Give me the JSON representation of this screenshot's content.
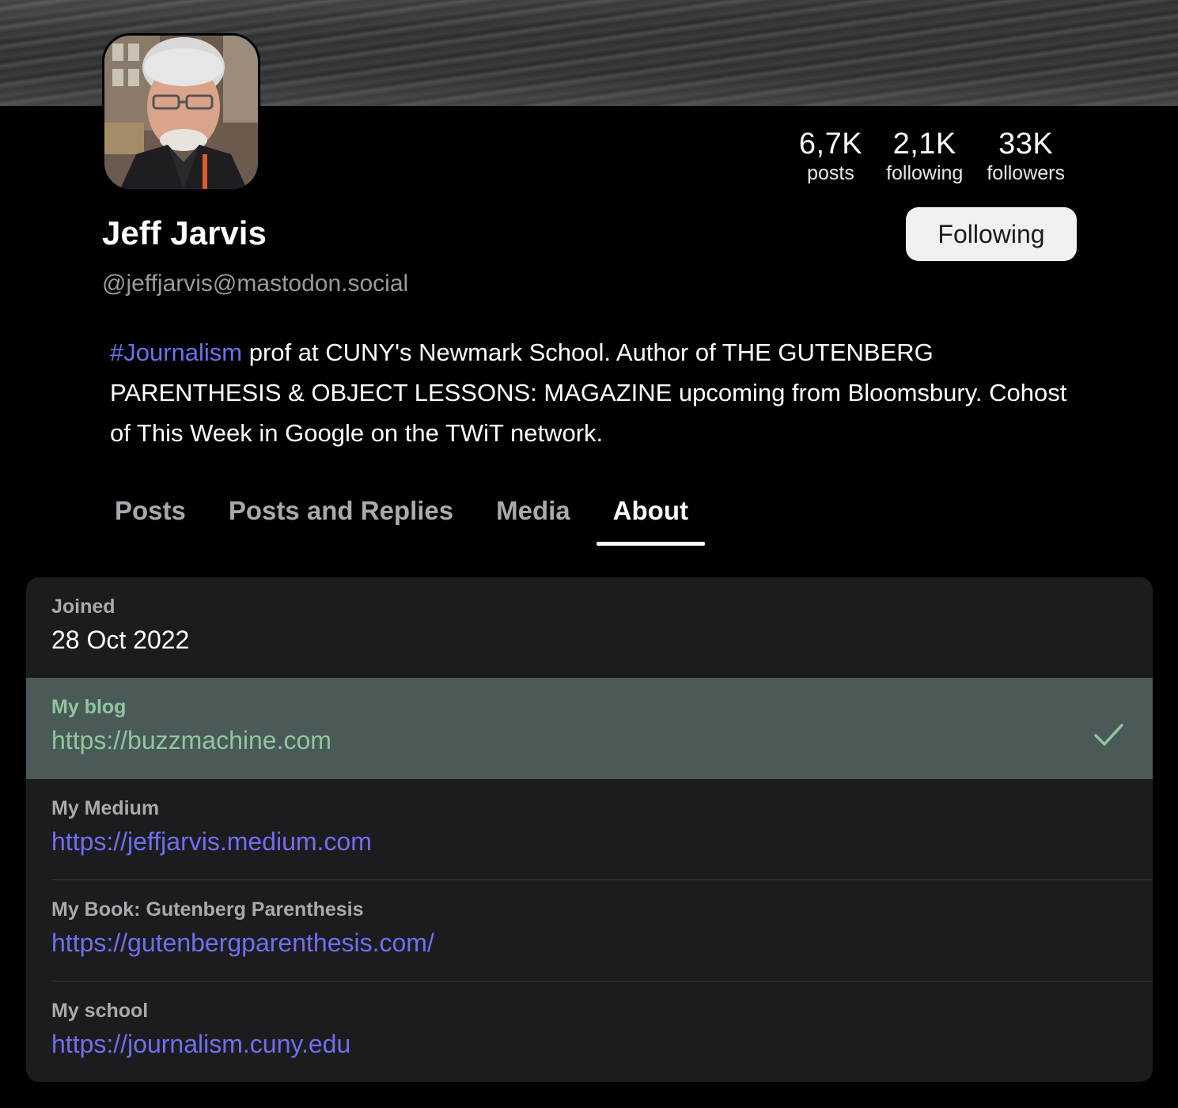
{
  "profile": {
    "display_name": "Jeff Jarvis",
    "handle": "@jeffjarvis@mastodon.social",
    "follow_button": "Following"
  },
  "stats": [
    {
      "value": "6,7K",
      "label": "posts"
    },
    {
      "value": "2,1K",
      "label": "following"
    },
    {
      "value": "33K",
      "label": "followers"
    }
  ],
  "bio": {
    "hashtag": "#Journalism",
    "text": " prof at CUNY's Newmark School. Author of THE GUTENBERG PARENTHESIS & OBJECT LESSONS: MAGAZINE upcoming from Bloomsbury. Cohost of This Week in Google on the TWiT network."
  },
  "tabs": [
    {
      "label": "Posts",
      "active": false
    },
    {
      "label": "Posts and Replies",
      "active": false
    },
    {
      "label": "Media",
      "active": false
    },
    {
      "label": "About",
      "active": true
    }
  ],
  "about": {
    "joined": {
      "label": "Joined",
      "value": "28 Oct 2022"
    },
    "fields": [
      {
        "label": "My blog",
        "value": "https://buzzmachine.com",
        "verified": true
      },
      {
        "label": "My Medium",
        "value": "https://jeffjarvis.medium.com",
        "verified": false
      },
      {
        "label": "My Book: Gutenberg Parenthesis",
        "value": "https://gutenbergparenthesis.com/",
        "verified": false
      },
      {
        "label": "My school",
        "value": "https://journalism.cuny.edu",
        "verified": false
      }
    ]
  },
  "colors": {
    "link": "#6f6ff0",
    "verified_bg": "#4a5a58",
    "verified_text": "#8fc79b",
    "card_bg": "#1c1c1e"
  },
  "icons": {
    "verified": "checkmark-icon"
  }
}
